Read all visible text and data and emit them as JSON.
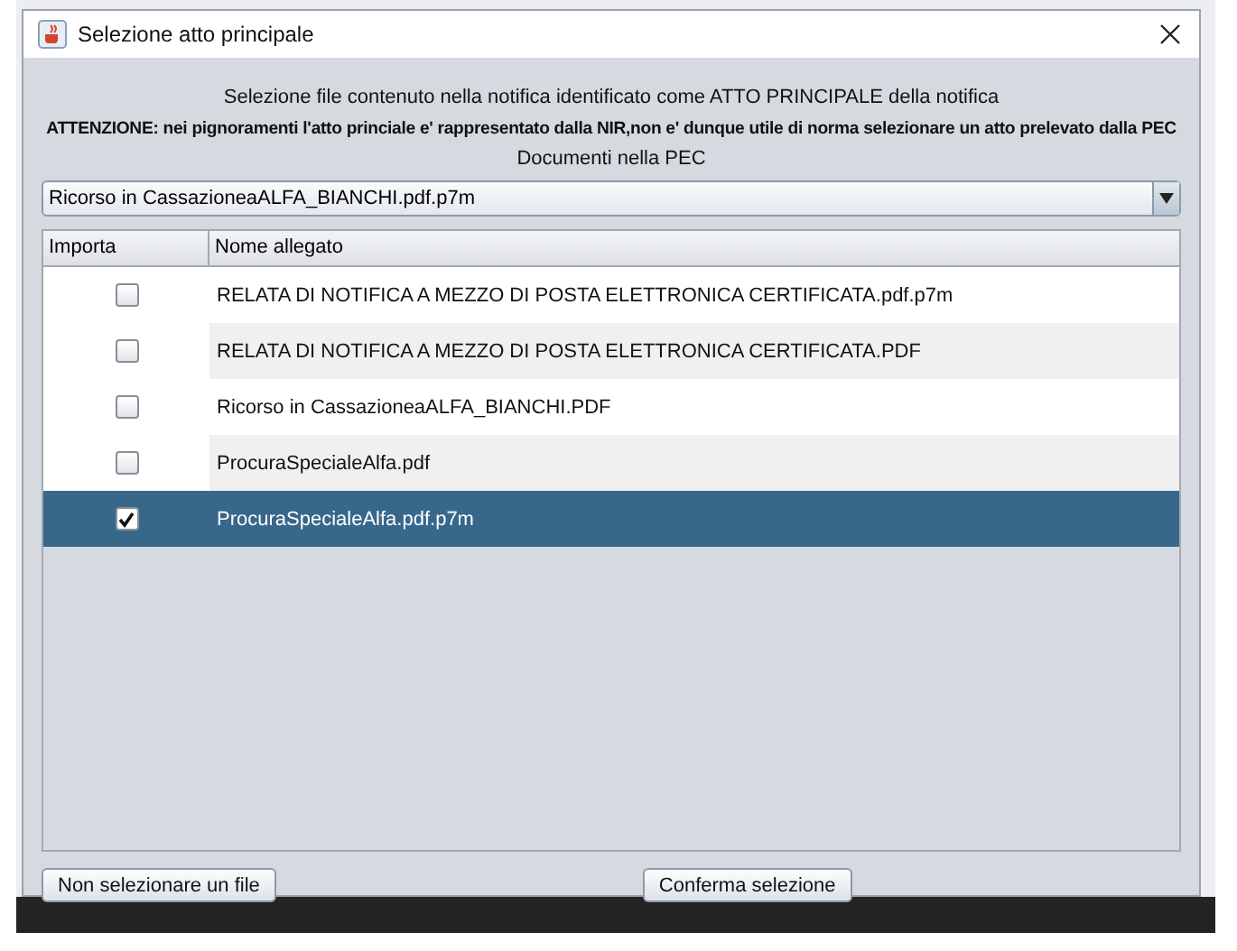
{
  "window": {
    "title": "Selezione atto principale"
  },
  "intro": "Selezione file contenuto nella notifica identificato come ATTO PRINCIPALE della notifica",
  "warning": "ATTENZIONE: nei pignoramenti l'atto princiale e' rappresentato dalla NIR,non e' dunque utile di norma selezionare un atto prelevato dalla PEC",
  "documents_label": "Documenti nella PEC",
  "dropdown": {
    "value": "Ricorso in CassazioneaALFA_BIANCHI.pdf.p7m"
  },
  "table": {
    "columns": [
      "Importa",
      "Nome allegato"
    ],
    "rows": [
      {
        "name": "RELATA DI NOTIFICA A MEZZO DI POSTA ELETTRONICA CERTIFICATA.pdf.p7m",
        "checked": false,
        "selected": false
      },
      {
        "name": "RELATA DI NOTIFICA A MEZZO DI POSTA ELETTRONICA CERTIFICATA.PDF",
        "checked": false,
        "selected": false
      },
      {
        "name": "Ricorso in CassazioneaALFA_BIANCHI.PDF",
        "checked": false,
        "selected": false
      },
      {
        "name": "ProcuraSpecialeAlfa.pdf",
        "checked": false,
        "selected": false
      },
      {
        "name": "ProcuraSpecialeAlfa.pdf.p7m",
        "checked": true,
        "selected": true
      }
    ]
  },
  "buttons": [
    "Non selezionare un file",
    "Conferma selezione"
  ]
}
